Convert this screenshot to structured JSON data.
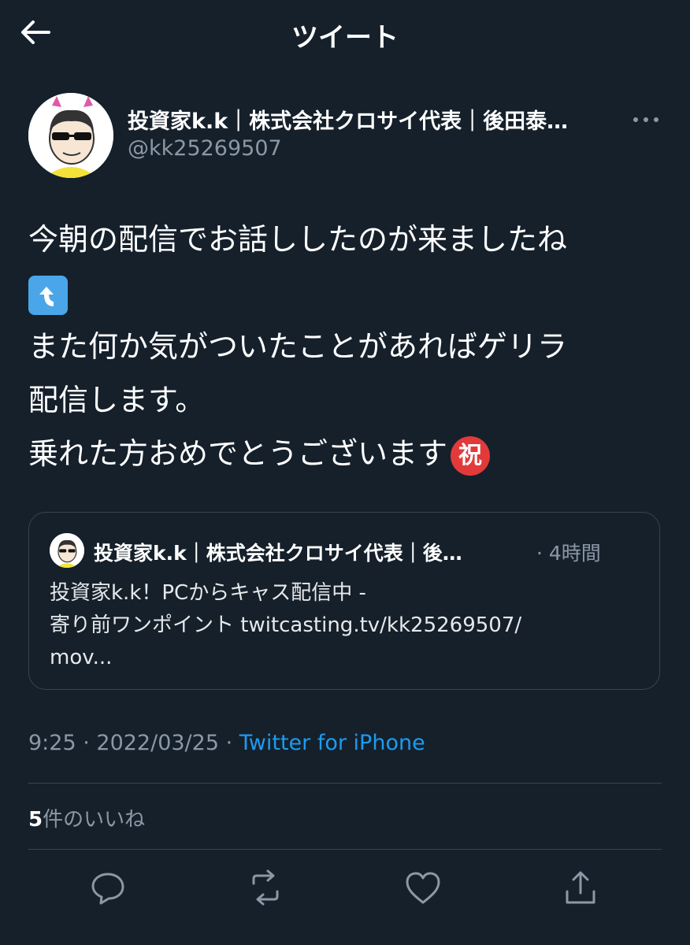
{
  "header": {
    "title": "ツイート"
  },
  "author": {
    "name": "投資家k.k｜株式会社クロサイ代表｜後田泰…",
    "handle": "@kk25269507"
  },
  "tweet": {
    "lines": [
      "今朝の配信でお話ししたのが来ましたね",
      "また何か気がついたことがあればゲリラ",
      "配信します。",
      "乗れた方おめでとうございます"
    ],
    "emoji_iwai": "祝"
  },
  "quoted": {
    "name": "投資家k.k｜株式会社クロサイ代表｜後…",
    "time": "· 4時間",
    "lines": [
      "投資家k.k！PCからキャス配信中 -",
      "寄り前ワンポイント twitcasting.tv/kk25269507/",
      "mov..."
    ]
  },
  "meta": {
    "time": "9:25",
    "sep1": " · ",
    "date": "2022/03/25",
    "sep2": " · ",
    "source": "Twitter for iPhone"
  },
  "likes": {
    "count": "5",
    "label": "件のいいね"
  },
  "icons": {
    "back": "arrow-left-icon",
    "more": "ellipsis-icon",
    "reply": "reply-icon",
    "retweet": "retweet-icon",
    "like": "heart-icon",
    "share": "share-icon"
  },
  "colors": {
    "background": "#15202b",
    "accent": "#1d9bf0",
    "muted": "#8b98a5",
    "border": "#38444d"
  }
}
